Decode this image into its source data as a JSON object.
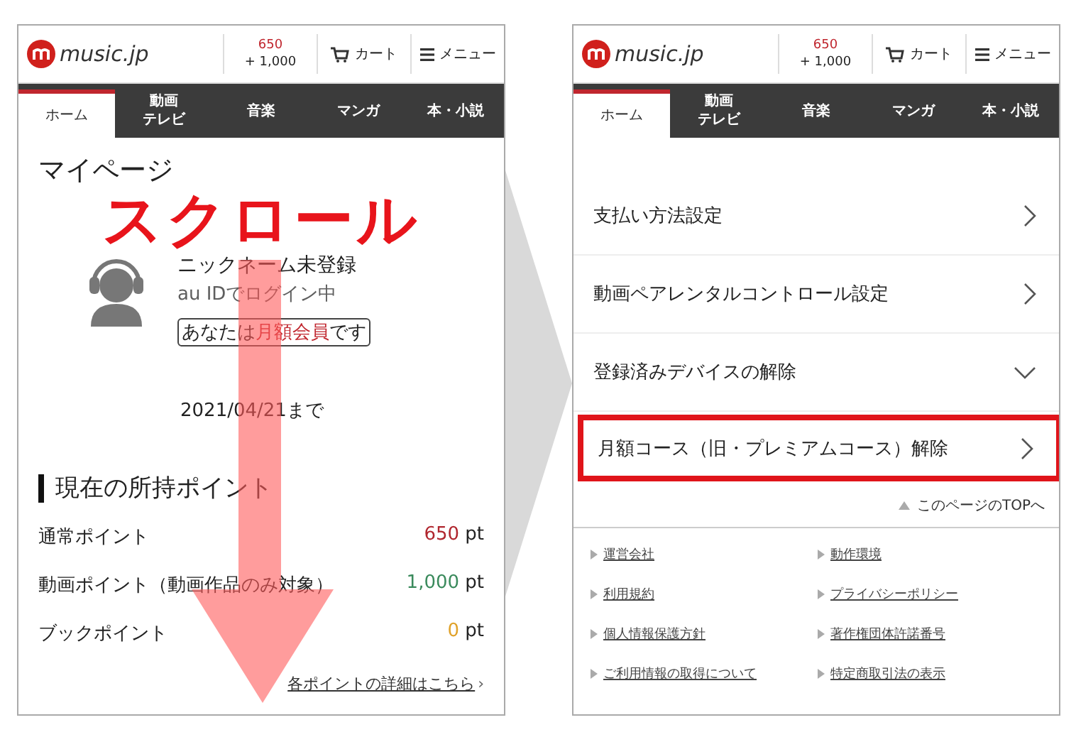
{
  "screens": [
    {
      "header": {
        "logo": "music.jp",
        "points": "650",
        "points_extra": "+ 1,000",
        "cart": "カート",
        "menu": "メニュー"
      },
      "tabs": [
        {
          "lines": [
            "ホーム"
          ],
          "selected": true
        },
        {
          "lines": [
            "動画",
            "テレビ"
          ],
          "selected": false
        },
        {
          "lines": [
            "音楽"
          ],
          "selected": false
        },
        {
          "lines": [
            "マンガ"
          ],
          "selected": false
        },
        {
          "lines": [
            "本・小説"
          ],
          "selected": false
        }
      ],
      "kind": "mypage",
      "title": "マイページ",
      "nickname": "ニックネーム未登録",
      "login": "au IDでログイン中",
      "member": {
        "before": "あなたは",
        "highlight": "月額会員",
        "after": "です"
      },
      "expiry": "2021/04/21まで",
      "points_heading": "現在の所持ポイント",
      "points": [
        {
          "label": "通常ポイント",
          "value": "650",
          "unit": "pt",
          "color": "#b0262e"
        },
        {
          "label": "動画ポイント（動画作品のみ対象）",
          "value": "1,000",
          "unit": "pt",
          "color": "#3a8a5c"
        },
        {
          "label": "ブックポイント",
          "value": "0",
          "unit": "pt",
          "color": "#e0a22a"
        }
      ],
      "details_link": "各ポイントの詳細はこちら",
      "details_arrow": "›"
    },
    {
      "header": {
        "logo": "music.jp",
        "points": "650",
        "points_extra": "+ 1,000",
        "cart": "カート",
        "menu": "メニュー"
      },
      "tabs": [
        {
          "lines": [
            "ホーム"
          ],
          "selected": true
        },
        {
          "lines": [
            "動画",
            "テレビ"
          ],
          "selected": false
        },
        {
          "lines": [
            "音楽"
          ],
          "selected": false
        },
        {
          "lines": [
            "マンガ"
          ],
          "selected": false
        },
        {
          "lines": [
            "本・小説"
          ],
          "selected": false
        }
      ],
      "kind": "settings",
      "menu_items": [
        {
          "label": "支払い方法設定",
          "kind": "link",
          "highlighted": false
        },
        {
          "label": "動画ペアレンタルコントロール設定",
          "kind": "link",
          "highlighted": false
        },
        {
          "label": "登録済みデバイスの解除",
          "kind": "expand",
          "highlighted": false
        },
        {
          "label": "月額コース（旧・プレミアムコース）解除",
          "kind": "link",
          "highlighted": true
        }
      ],
      "top_link": "このページのTOPへ",
      "footer_links": [
        "運営会社",
        "動作環境",
        "利用規約",
        "プライバシーポリシー",
        "個人情報保護方針",
        "著作権団体許諾番号",
        "ご利用情報の取得について",
        "特定商取引法の表示"
      ]
    }
  ],
  "annotation": {
    "text": "スクロール"
  }
}
